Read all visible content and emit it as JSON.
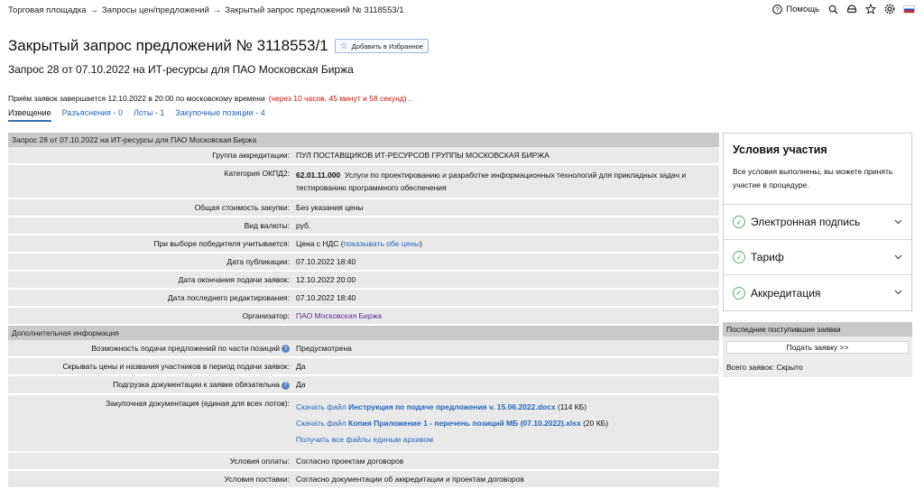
{
  "breadcrumb": [
    "Торговая площадка",
    "Запросы цен/предложений",
    "Закрытый запрос предложений № 3118553/1"
  ],
  "breadcrumb_sep": "→",
  "header": {
    "help_label": "Помощь",
    "icons": [
      "search-icon",
      "support-icon",
      "star-icon",
      "settings-icon",
      "flag-ru-icon"
    ]
  },
  "title": "Закрытый запрос предложений № 3118553/1",
  "favorite_button": "Добавить в Избранное",
  "subtitle": "Запрос 28 от 07.10.2022 на ИТ-ресурсы для ПАО Московская Биржа",
  "deadline": {
    "text": "Приём заявок завершается 12.10.2022 в 20:00 по московскому времени",
    "countdown": "(через 10 часов, 45 минут и 58 секунд)",
    "tail": "."
  },
  "tabs": [
    "Извещение",
    "Разъяснения - 0",
    "Лоты - 1",
    "Закупочные позиции - 4"
  ],
  "section1": {
    "title": "Запрос 28 от 07.10.2022 на ИТ-ресурсы для ПАО Московская Биржа",
    "rows": {
      "group_label": "Группа аккредитации:",
      "group_value": "ПУЛ ПОСТАВЩИКОВ ИТ-РЕСУРСОВ ГРУППЫ МОСКОВСКАЯ БИРЖА",
      "okpd_label": "Категория ОКПД2:",
      "okpd_code": "62.01.11.000",
      "okpd_text": "Услуги по проектированию и разработке информационных технологий для прикладных задач и тестированию программного обеспечения",
      "cost_label": "Общая стоимость закупки:",
      "cost_value": "Без указания цены",
      "currency_label": "Вид валюты:",
      "currency_value": "руб.",
      "winner_label": "При выборе победителя учитывается:",
      "winner_value": "Цена с НДС (",
      "winner_link": "показывать обе цены",
      "winner_close": ")",
      "pub_label": "Дата публикации:",
      "pub_value": "07.10.2022 18:40",
      "end_label": "Дата окончания подачи заявок:",
      "end_value": "12.10.2022 20:00",
      "edit_label": "Дата последнего редактирования:",
      "edit_value": "07.10.2022 18:40",
      "org_label": "Организатор:",
      "org_value": "ПАО Московская Биржа"
    }
  },
  "section2": {
    "title": "Дополнительная информация",
    "rows": {
      "partial_label": "Возможность подачи предложений по части позиций",
      "partial_value": "Предусмотрена",
      "hide_label": "Скрывать цены и названия участников в период подачи заявок:",
      "hide_value": "Да",
      "docs_req_label": "Подгрузка документации к заявке обязательна",
      "docs_req_value": "Да",
      "docs_label": "Закупочная документация (единая для всех лотов):",
      "file1_prefix": "Скачать файл",
      "file1_name": "Инструкция по подаче предложения v. 15.06.2022.docx",
      "file1_size": "(114 КБ)",
      "file2_prefix": "Скачать файл",
      "file2_name": "Копия Приложение 1 - перечень позиций МБ (07.10.2022).xlsx",
      "file2_size": "(20 КБ)",
      "all_files": "Получить все файлы единым архивом",
      "payment_label": "Условия оплаты:",
      "payment_value": "Согласно проектам договоров",
      "delivery_label": "Условия поставки:",
      "delivery_value": "Согласно документации об аккредитации и проектам договоров"
    }
  },
  "participation": {
    "title": "Условия участия",
    "text": "Все условия выполнены, вы можете принять участие в процедуре.",
    "items": [
      "Электронная подпись",
      "Тариф",
      "Аккредитация"
    ]
  },
  "recent": {
    "title": "Последние поступившие заявки",
    "button": "Подать заявку >>",
    "total": "Всего заявок: Скрыто"
  }
}
